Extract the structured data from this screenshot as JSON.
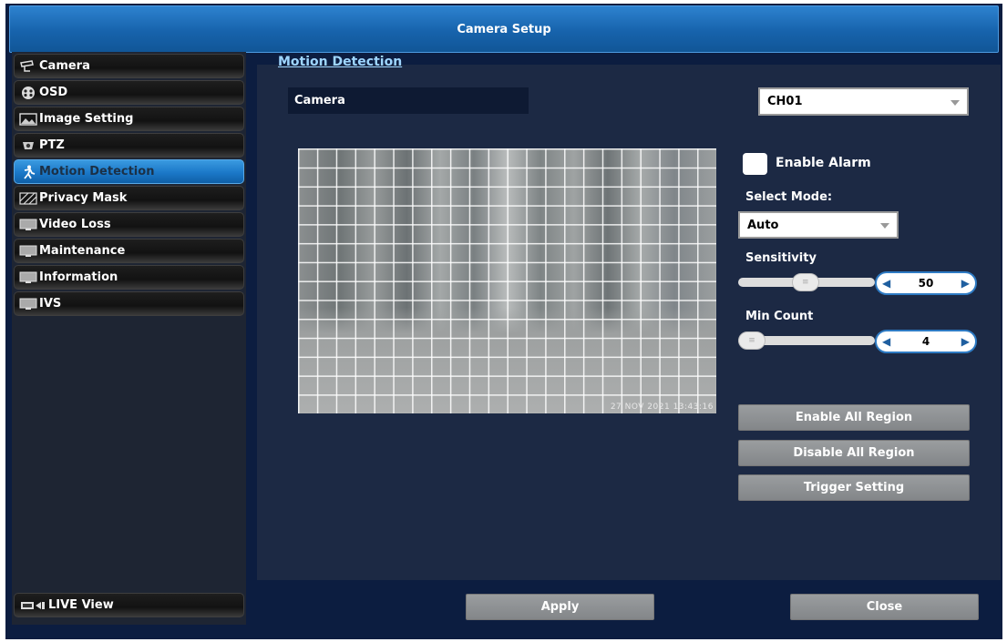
{
  "window": {
    "title": "Camera Setup"
  },
  "sidebar": {
    "items": [
      {
        "label": "Camera",
        "icon": "camera-icon"
      },
      {
        "label": "OSD",
        "icon": "osd-icon"
      },
      {
        "label": "Image Setting",
        "icon": "image-icon"
      },
      {
        "label": "PTZ",
        "icon": "ptz-icon"
      },
      {
        "label": "Motion Detection",
        "icon": "motion-icon",
        "active": true
      },
      {
        "label": "Privacy Mask",
        "icon": "mask-icon"
      },
      {
        "label": "Video Loss",
        "icon": "monitor-icon"
      },
      {
        "label": "Maintenance",
        "icon": "monitor-icon"
      },
      {
        "label": "Information",
        "icon": "monitor-icon"
      },
      {
        "label": "IVS",
        "icon": "monitor-icon"
      }
    ],
    "live_view": {
      "label": "LIVE View",
      "icon": "live-view-icon"
    }
  },
  "main": {
    "section_title": "Motion Detection",
    "camera_label": "Camera",
    "channel": "CH01",
    "video_osd": "27 NOV 2021 13:43:16",
    "enable_alarm": {
      "label": "Enable Alarm",
      "checked": false
    },
    "select_mode": {
      "label": "Select Mode:",
      "value": "Auto"
    },
    "sensitivity": {
      "label": "Sensitivity",
      "value": "50",
      "level": 0.49
    },
    "min_count": {
      "label": "Min Count",
      "value": "4",
      "level": 0.0
    },
    "buttons": {
      "enable_all": "Enable All Region",
      "disable_all": "Disable All Region",
      "trigger": "Trigger Setting"
    }
  },
  "footer": {
    "apply": "Apply",
    "close": "Close"
  },
  "colors": {
    "accent": "#1b78c8",
    "title_bar": "#1763ac",
    "section_link": "#9fd6ff",
    "panel": "#1c2944"
  }
}
